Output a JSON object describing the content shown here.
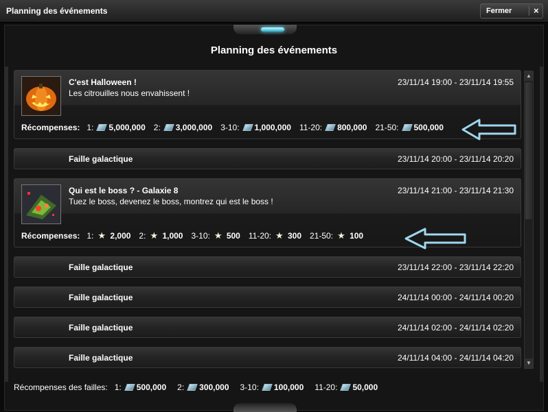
{
  "window": {
    "title": "Planning des événements",
    "close_label": "Fermer",
    "close_glyph": "×"
  },
  "heading": "Planning des événements",
  "events": [
    {
      "name": "C'est Halloween !",
      "date": "23/11/14 19:00 - 23/11/14 19:55",
      "description": "Les citrouilles nous envahissent !",
      "rewards_label": "Récompenses:",
      "reward_icon": "gem-icon",
      "rewards": [
        {
          "rank": "1:",
          "value": "5,000,000"
        },
        {
          "rank": "2:",
          "value": "3,000,000"
        },
        {
          "rank": "3-10:",
          "value": "1,000,000"
        },
        {
          "rank": "11-20:",
          "value": "800,000"
        },
        {
          "rank": "21-50:",
          "value": "500,000"
        }
      ]
    },
    {
      "name": "Faille galactique",
      "date": "23/11/14 20:00 - 23/11/14 20:20"
    },
    {
      "name": "Qui est le boss ?  -  Galaxie 8",
      "date": "23/11/14 21:00 - 23/11/14 21:30",
      "description": "Tuez le boss, devenez le boss, montrez qui est le boss !",
      "rewards_label": "Récompenses:",
      "reward_icon": "star-icon",
      "rewards": [
        {
          "rank": "1:",
          "value": "2,000"
        },
        {
          "rank": "2:",
          "value": "1,000"
        },
        {
          "rank": "3-10:",
          "value": "500"
        },
        {
          "rank": "11-20:",
          "value": "300"
        },
        {
          "rank": "21-50:",
          "value": "100"
        }
      ]
    },
    {
      "name": "Faille galactique",
      "date": "23/11/14 22:00 - 23/11/14 22:20"
    },
    {
      "name": "Faille galactique",
      "date": "24/11/14 00:00 - 24/11/14 00:20"
    },
    {
      "name": "Faille galactique",
      "date": "24/11/14 02:00 - 24/11/14 02:20"
    },
    {
      "name": "Faille galactique",
      "date": "24/11/14 04:00 - 24/11/14 04:20"
    }
  ],
  "footer": {
    "label": "Récompenses des failles:",
    "rewards": [
      {
        "rank": "1:",
        "value": "500,000"
      },
      {
        "rank": "2:",
        "value": "300,000"
      },
      {
        "rank": "3-10:",
        "value": "100,000"
      },
      {
        "rank": "11-20:",
        "value": "50,000"
      }
    ]
  },
  "colors": {
    "accent_glow": "#5ddcff",
    "annotation_arrow": "#9fd8ee"
  }
}
